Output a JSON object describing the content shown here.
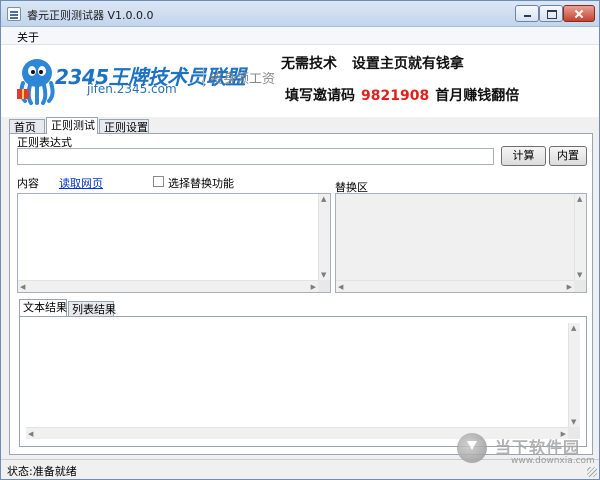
{
  "window": {
    "title": "睿元正则测试器 V1.0.0.0"
  },
  "menu": {
    "items": [
      "关于"
    ]
  },
  "banner": {
    "logo_num": "2345",
    "logo_text": "王牌技术员联盟",
    "logo_site": "jifen.2345.com",
    "logo_slogan": "终身领工资",
    "promo_line1": "无需技术 设置主页就有钱拿",
    "promo_line2_prefix": "填写邀请码",
    "promo_code": "9821908",
    "promo_line2_suffix": "首月赚钱翻倍",
    "accent_color": "#1d72c4",
    "code_color": "#e2201a"
  },
  "tabs": [
    {
      "label": "首页",
      "active": false
    },
    {
      "label": "正则测试",
      "active": true
    },
    {
      "label": "正则设置",
      "active": false
    }
  ],
  "regex": {
    "label": "正则表达式",
    "value": "",
    "calc_button": "计算",
    "builtin_button": "内置"
  },
  "content": {
    "label": "内容",
    "fetch_link": "读取网页",
    "replace_checkbox_label": "选择替换功能",
    "replace_checked": false,
    "replace_area_label": "替换区"
  },
  "result_tabs": [
    {
      "label": "文本结果",
      "active": true
    },
    {
      "label": "列表结果",
      "active": false
    }
  ],
  "status": {
    "text": "状态:准备就绪"
  },
  "watermark": {
    "cn": "当下软件园",
    "en": "www.downxia.com"
  }
}
